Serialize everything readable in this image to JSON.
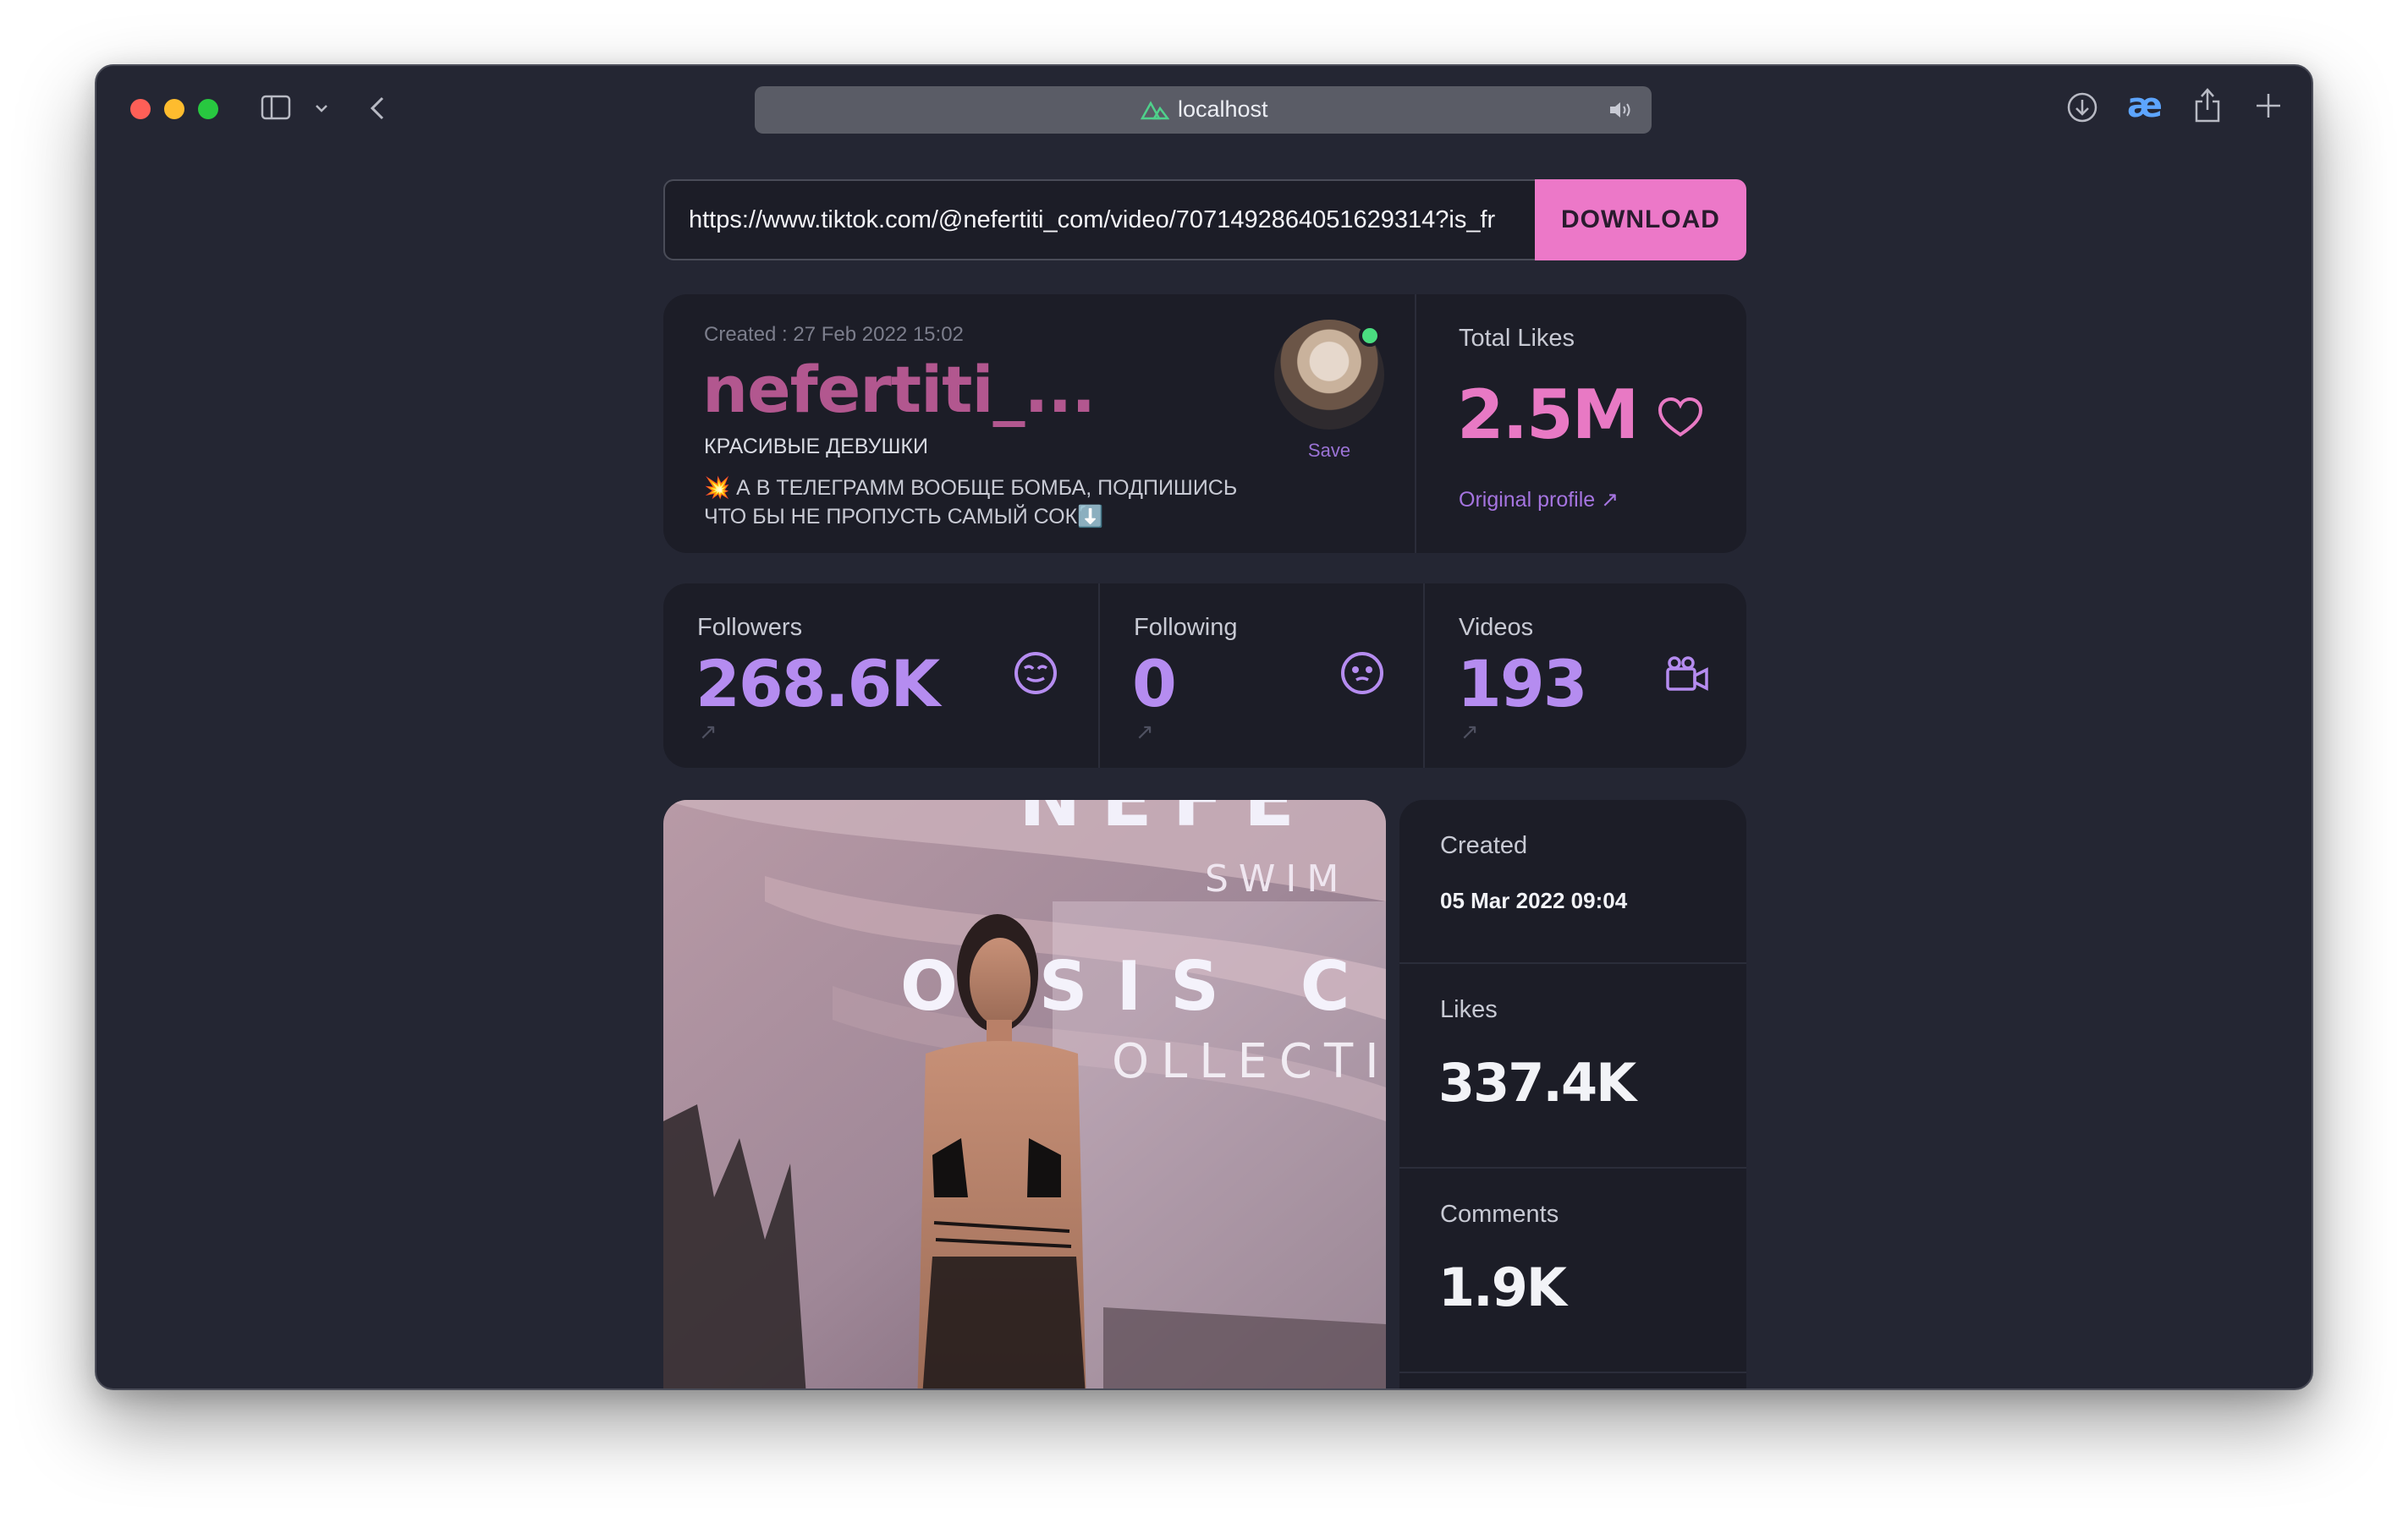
{
  "browser": {
    "address": "localhost",
    "accent_icon": "æ"
  },
  "search": {
    "url_value": "https://www.tiktok.com/@nefertiti_com/video/7071492864051629314?is_fr",
    "download_label": "DOWNLOAD"
  },
  "profile": {
    "created": "Created : 27 Feb 2022 15:02",
    "username": "nefertiti_...",
    "nickname": "КРАСИВЫЕ ДЕВУШКИ",
    "bio_line1": "💥 А В ТЕЛЕГРАММ ВООБЩЕ БОМБА, ПОДПИШИСЬ",
    "bio_line2": "ЧТО БЫ НЕ ПРОПУСТЬ САМЫЙ СОК⬇️",
    "save_label": "Save",
    "total_likes_label": "Total Likes",
    "total_likes_value": "2.5M",
    "original_profile_label": "Original profile ↗"
  },
  "stats": {
    "followers_label": "Followers",
    "followers_value": "268.6K",
    "following_label": "Following",
    "following_value": "0",
    "videos_label": "Videos",
    "videos_value": "193",
    "arrow": "↗"
  },
  "video": {
    "overlay_word1": "NEFE",
    "overlay_word2": "SWIM",
    "overlay_word3": "O SIS C",
    "overlay_word4": "OLLECTI",
    "created_label": "Created",
    "created_value": "05 Mar 2022 09:04",
    "likes_label": "Likes",
    "likes_value": "337.4K",
    "comments_label": "Comments",
    "comments_value": "1.9K"
  },
  "colors": {
    "accent_pink": "#ec78c8",
    "accent_purple": "#b58cf0",
    "username_color": "#b2578f",
    "background": "#242633",
    "card": "#1c1d27"
  }
}
